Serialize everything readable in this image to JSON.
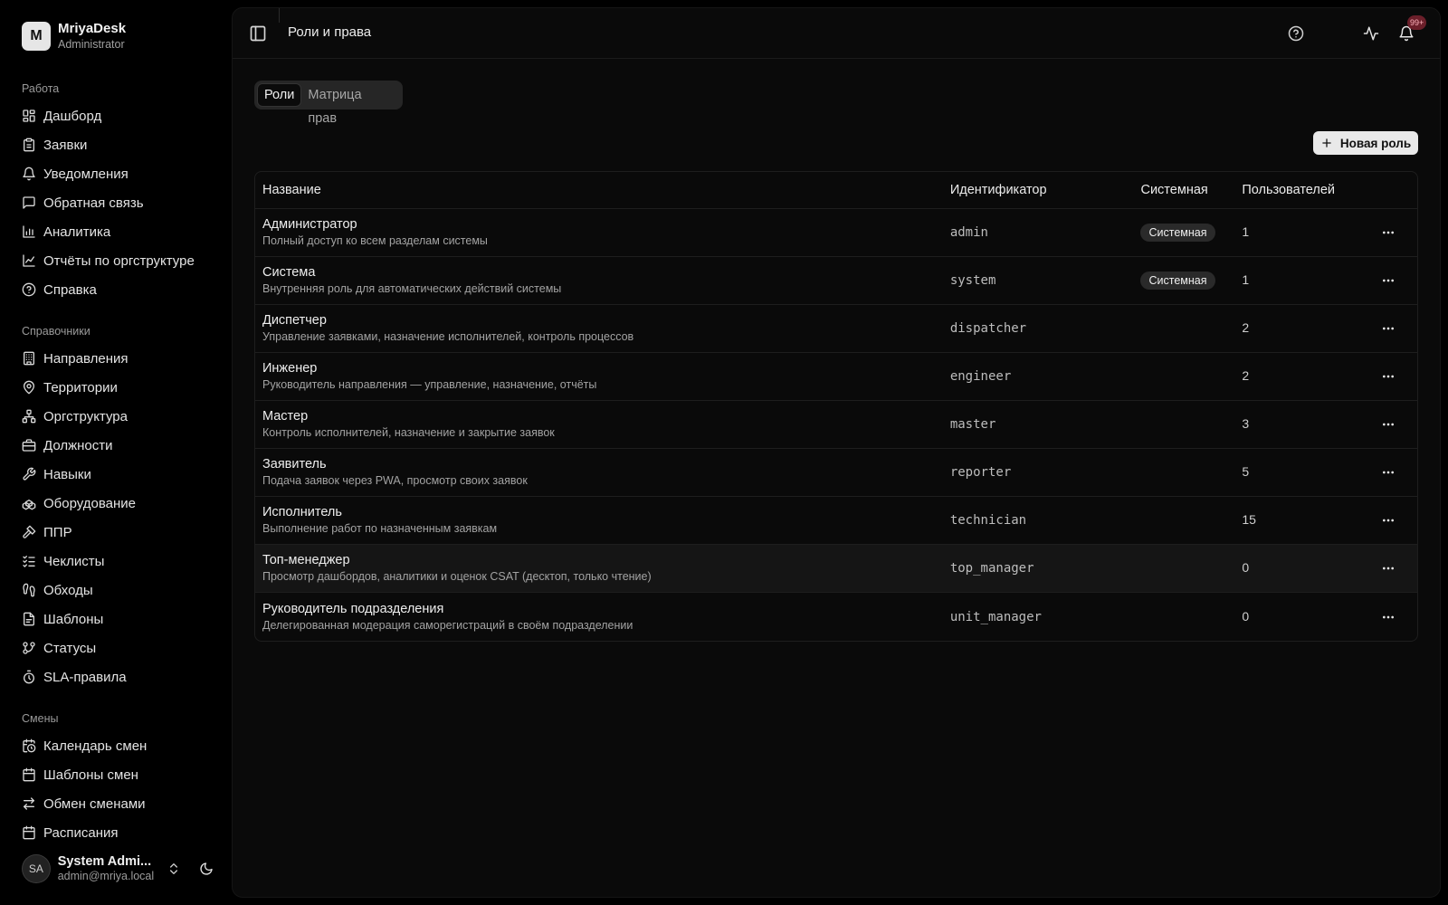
{
  "brand": {
    "logo_letter": "M",
    "name": "MriyaDesk",
    "role": "Administrator"
  },
  "sidebar": {
    "groups": [
      {
        "title": "Работа",
        "items": [
          {
            "label": "Дашборд",
            "icon": "dashboard-icon"
          },
          {
            "label": "Заявки",
            "icon": "clipboard-icon"
          },
          {
            "label": "Уведомления",
            "icon": "bell-icon"
          },
          {
            "label": "Обратная связь",
            "icon": "message-icon"
          },
          {
            "label": "Аналитика",
            "icon": "bar-chart-icon"
          },
          {
            "label": "Отчёты по оргструктуре",
            "icon": "line-chart-icon"
          },
          {
            "label": "Справка",
            "icon": "help-circle-icon"
          }
        ]
      },
      {
        "title": "Справочники",
        "items": [
          {
            "label": "Направления",
            "icon": "building-icon"
          },
          {
            "label": "Территории",
            "icon": "map-pin-icon"
          },
          {
            "label": "Оргструктура",
            "icon": "network-icon"
          },
          {
            "label": "Должности",
            "icon": "briefcase-icon"
          },
          {
            "label": "Навыки",
            "icon": "wrench-icon"
          },
          {
            "label": "Оборудование",
            "icon": "cubes-icon"
          },
          {
            "label": "ППР",
            "icon": "hammer-icon"
          },
          {
            "label": "Чеклисты",
            "icon": "checklist-icon"
          },
          {
            "label": "Обходы",
            "icon": "footprints-icon"
          },
          {
            "label": "Шаблоны",
            "icon": "file-template-icon"
          },
          {
            "label": "Статусы",
            "icon": "git-branch-icon"
          },
          {
            "label": "SLA-правила",
            "icon": "timer-icon"
          }
        ]
      },
      {
        "title": "Смены",
        "items": [
          {
            "label": "Календарь смен",
            "icon": "calendar-clock-icon"
          },
          {
            "label": "Шаблоны смен",
            "icon": "calendar-icon"
          },
          {
            "label": "Обмен сменами",
            "icon": "swap-icon"
          },
          {
            "label": "Расписания",
            "icon": "calendar-icon"
          }
        ]
      }
    ]
  },
  "user": {
    "initials": "SA",
    "name": "System Admi...",
    "email": "admin@mriya.local"
  },
  "header": {
    "title": "Роли и права",
    "notifications_badge": "99+"
  },
  "tabs": [
    {
      "label": "Роли",
      "active": true
    },
    {
      "label": "Матрица прав",
      "active": false
    }
  ],
  "toolbar": {
    "new_role_label": "Новая роль"
  },
  "table": {
    "columns": [
      "Название",
      "Идентификатор",
      "Системная",
      "Пользователей"
    ],
    "rows": [
      {
        "name": "Администратор",
        "description": "Полный доступ ко всем разделам системы",
        "id": "admin",
        "system": "Системная",
        "users": "1"
      },
      {
        "name": "Система",
        "description": "Внутренняя роль для автоматических действий системы",
        "id": "system",
        "system": "Системная",
        "users": "1"
      },
      {
        "name": "Диспетчер",
        "description": "Управление заявками, назначение исполнителей, контроль процессов",
        "id": "dispatcher",
        "system": "",
        "users": "2"
      },
      {
        "name": "Инженер",
        "description": "Руководитель направления — управление, назначение, отчёты",
        "id": "engineer",
        "system": "",
        "users": "2"
      },
      {
        "name": "Мастер",
        "description": "Контроль исполнителей, назначение и закрытие заявок",
        "id": "master",
        "system": "",
        "users": "3"
      },
      {
        "name": "Заявитель",
        "description": "Подача заявок через PWA, просмотр своих заявок",
        "id": "reporter",
        "system": "",
        "users": "5"
      },
      {
        "name": "Исполнитель",
        "description": "Выполнение работ по назначенным заявкам",
        "id": "technician",
        "system": "",
        "users": "15"
      },
      {
        "name": "Топ-менеджер",
        "description": "Просмотр дашбордов, аналитики и оценок CSAT (десктоп, только чтение)",
        "id": "top_manager",
        "system": "",
        "users": "0",
        "highlighted": true
      },
      {
        "name": "Руководитель подразделения",
        "description": "Делегированная модерация саморегистраций в своём подразделении",
        "id": "unit_manager",
        "system": "",
        "users": "0"
      }
    ]
  }
}
